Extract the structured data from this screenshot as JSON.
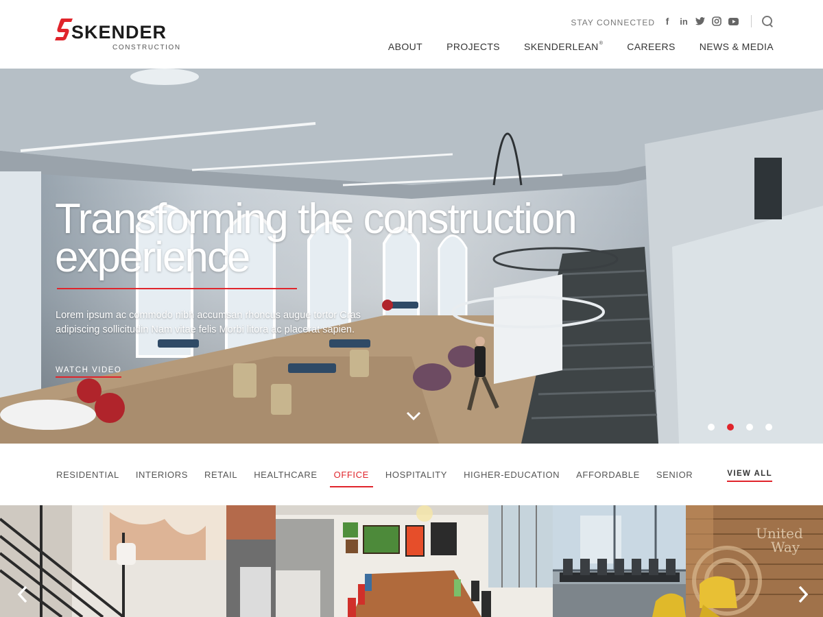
{
  "brand": {
    "name": "SKENDER",
    "subtitle": "CONSTRUCTION",
    "accent_color": "#e0242b"
  },
  "utility": {
    "stay_connected": "STAY CONNECTED",
    "social_icons": [
      "facebook-icon",
      "linkedin-icon",
      "twitter-icon",
      "instagram-icon",
      "youtube-icon"
    ],
    "search_icon": "search-icon"
  },
  "nav": {
    "items": [
      {
        "label": "ABOUT"
      },
      {
        "label": "PROJECTS"
      },
      {
        "label": "SKENDERLEAN",
        "mark": "®"
      },
      {
        "label": "CAREERS"
      },
      {
        "label": "NEWS & MEDIA"
      }
    ]
  },
  "hero": {
    "title": "Transforming the construction experience",
    "body": "Lorem ipsum ac commodo nibh accumsan rhoncus augue tortor Cras adipiscing sollicitudin Nam vitae felis Morbi litora ac placerat sapien.",
    "cta": "WATCH VIDEO",
    "slides_total": 4,
    "active_slide": 2
  },
  "filters": {
    "items": [
      {
        "label": "RESIDENTIAL",
        "active": false
      },
      {
        "label": "INTERIORS",
        "active": false
      },
      {
        "label": "RETAIL",
        "active": false
      },
      {
        "label": "HEALTHCARE",
        "active": false
      },
      {
        "label": "OFFICE",
        "active": true
      },
      {
        "label": "HOSPITALITY",
        "active": false
      },
      {
        "label": "HIGHER-EDUCATION",
        "active": false
      },
      {
        "label": "AFFORDABLE",
        "active": false
      },
      {
        "label": "SENIOR",
        "active": false
      }
    ],
    "view_all": "VIEW ALL"
  },
  "projects": {
    "tiles": [
      {
        "name": "project-tile-staircase"
      },
      {
        "name": "project-tile-kitchen"
      },
      {
        "name": "project-tile-conference"
      },
      {
        "name": "project-tile-united-way",
        "sign": "United Way"
      }
    ]
  }
}
